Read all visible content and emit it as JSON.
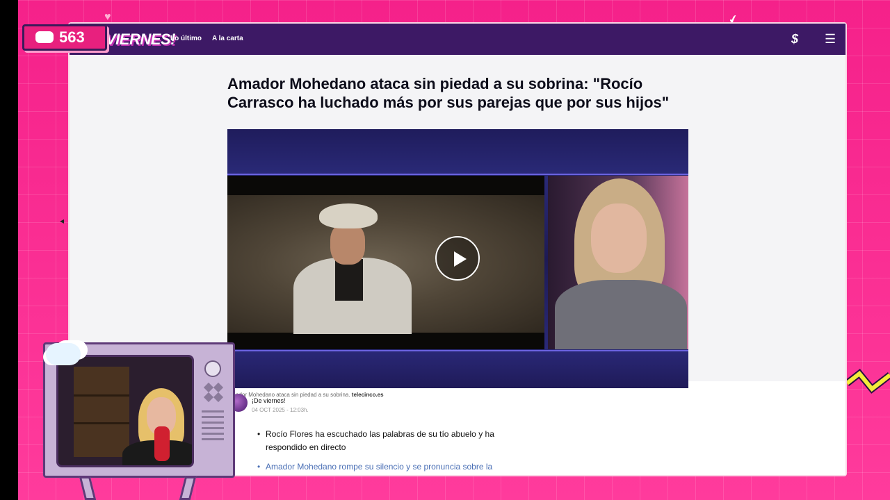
{
  "stream": {
    "viewer_count": "563",
    "deco_heart": "♥",
    "deco_check": "✔",
    "left_arrow": "◂"
  },
  "site": {
    "logo": "VIERNES!",
    "nav": [
      "Lo último",
      "A la carta"
    ],
    "header_icon_s": "$",
    "header_icon_menu": "☰"
  },
  "article": {
    "headline": "Amador Mohedano ataca sin piedad a su sobrina: \"Rocío Carrasco ha luchado más por sus parejas que por sus hijos\"",
    "caption_text": "Amador Mohedano ataca sin piedad a su sobrina. ",
    "caption_source": "telecinco.es",
    "author": "¡De viernes!",
    "date": "04 OCT 2025 - 12:03h.",
    "bullets": [
      "Rocío Flores ha escuchado las palabras de su tío abuelo y ha respondido en directo",
      "Amador Mohedano rompe su silencio y se pronuncia sobre la"
    ]
  },
  "colors": {
    "background": "#f0208a",
    "header": "#3d1965",
    "link": "#4a6fb5",
    "tv_frame": "#c7b3d6"
  }
}
